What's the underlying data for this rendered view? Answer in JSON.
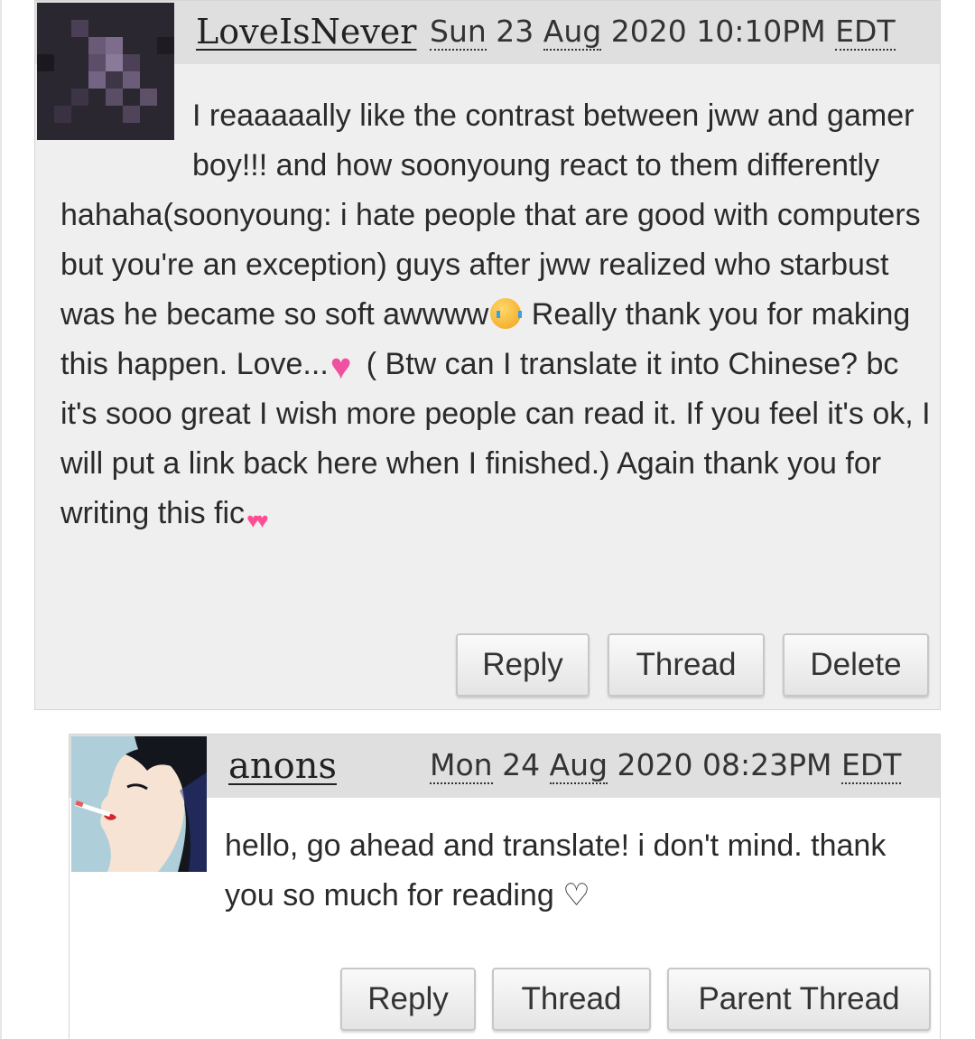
{
  "comments": [
    {
      "username": "LoveIsNever",
      "date": {
        "weekday": "Sun",
        "day": "23",
        "month": "Aug",
        "year": "2020",
        "time": "10:10PM",
        "tz": "EDT"
      },
      "body": [
        "I reaaaaally like the contrast between jww and gamer boy!!! and how soonyoung react to them differently hahaha(soonyoung: i hate people that are good with computers but you're an exception) guys after jww realized who starbust was he became so soft awwww",
        " Really thank you for making this happen. Love...",
        "( Btw can I translate it into Chinese? bc it's sooo great I wish more people can read it. If you feel it's ok, I will put a link back here when I finished.) Again thank you for writing this fic"
      ],
      "emojis": [
        "loudly-crying-face-emoji",
        "sparkling-heart-emoji",
        "two-hearts-emoji"
      ],
      "actions": [
        "Reply",
        "Thread",
        "Delete"
      ]
    },
    {
      "username": "anons",
      "date": {
        "weekday": "Mon",
        "day": "24",
        "month": "Aug",
        "year": "2020",
        "time": "08:23PM",
        "tz": "EDT"
      },
      "body": [
        "hello, go ahead and translate! i don't mind. thank you so much for reading ♡"
      ],
      "actions": [
        "Reply",
        "Thread",
        "Parent Thread"
      ]
    }
  ],
  "colors": {
    "byline_bg": "#dfdfdf",
    "comment_bg": "#efefef",
    "button_border": "#c7c7c7"
  }
}
